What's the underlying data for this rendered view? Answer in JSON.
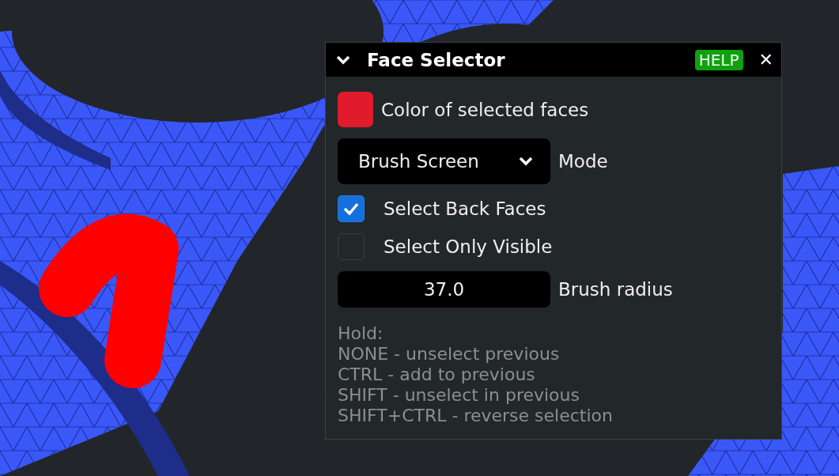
{
  "panel": {
    "title": "Face Selector",
    "expanded": true,
    "help": "HELP",
    "close": "✕",
    "color_setting": {
      "label": "Color of selected faces",
      "color": "#e01b2c"
    },
    "mode": {
      "value": "Brush Screen",
      "label": "Mode"
    },
    "options": [
      {
        "label": "Select Back Faces",
        "checked": true
      },
      {
        "label": "Select Only Visible",
        "checked": false
      }
    ],
    "radius": {
      "value": "37.0",
      "label": "Brush radius"
    },
    "hint": [
      "Hold:",
      "NONE - unselect previous",
      "CTRL - add to previous",
      "SHIFT - unselect in previous",
      "SHIFT+CTRL - reverse selection"
    ]
  }
}
